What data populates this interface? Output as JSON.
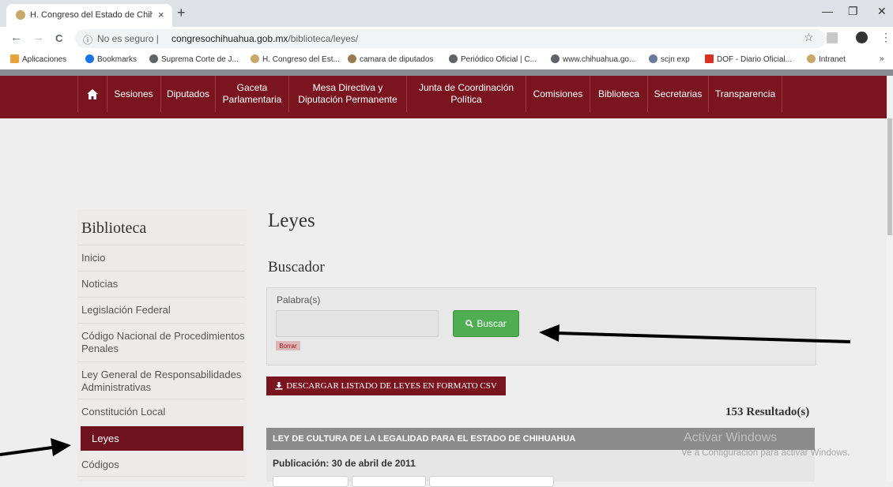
{
  "browser": {
    "tab_title": "H. Congreso del Estado de Chihu",
    "tab_close": "×",
    "new_tab": "+",
    "window_controls": [
      "—",
      "❐",
      "✕"
    ],
    "nav": {
      "back": "←",
      "forward": "→",
      "reload": "C"
    },
    "address": {
      "security_icon": "ⓘ",
      "security_text": "No es seguro  |",
      "url_domain": "congresochihuahua.gob.mx",
      "url_path": "/biblioteca/leyes/"
    },
    "toolbar_icons": [
      "☆",
      "⋮"
    ],
    "bookmarks": [
      {
        "label": "Aplicaciones",
        "icon": "apps-icon",
        "color": "#e8a33a"
      },
      {
        "label": "Bookmarks",
        "icon": "star-icon",
        "color": "#1a73e8"
      },
      {
        "label": "Suprema Corte de J...",
        "icon": "globe-icon",
        "color": "#5f6368"
      },
      {
        "label": "H. Congreso del Est...",
        "icon": "seal-icon",
        "color": "#c8a86a"
      },
      {
        "label": "camara de diputados",
        "icon": "seal-icon",
        "color": "#9a7b4f"
      },
      {
        "label": "Periódico Oficial | C...",
        "icon": "globe-icon",
        "color": "#5f6368"
      },
      {
        "label": "www.chihuahua.go...",
        "icon": "globe-icon",
        "color": "#5f6368"
      },
      {
        "label": "scjn exp",
        "icon": "bird-icon",
        "color": "#6b7a99"
      },
      {
        "label": "DOF - Diario Oficial...",
        "icon": "dof-icon",
        "color": "#d93025"
      },
      {
        "label": "Intranet",
        "icon": "seal-icon",
        "color": "#c8a86a"
      }
    ],
    "bookmarks_more": "»"
  },
  "site_nav": {
    "home_icon": "home-icon",
    "items": [
      "Sesiones",
      "Diputados",
      "Gaceta Parlamentaria",
      "Mesa Directiva y Diputación Permanente",
      "Junta de Coordinación Política",
      "Comisiones",
      "Biblioteca",
      "Secretarias",
      "Transparencia"
    ]
  },
  "sidebar": {
    "title": "Biblioteca",
    "items": [
      "Inicio",
      "Noticias",
      "Legislación Federal",
      "Código Nacional de Procedimientos Penales",
      "Ley General de Responsabilidades Administrativas",
      "Constitución Local",
      "Leyes",
      "Códigos"
    ],
    "active": "Leyes"
  },
  "main": {
    "heading": "Leyes",
    "search_heading": "Buscador",
    "field_label": "Palabra(s)",
    "field_value": "",
    "search_button": "Buscar",
    "clear_button": "Borrar",
    "csv_button": "DESCARGAR LISTADO DE LEYES EN FORMATO CSV",
    "results_count": "153 Resultado(s)",
    "first_law": {
      "title": "LEY DE CULTURA DE LA LEGALIDAD PARA EL ESTADO DE CHIHUAHUA",
      "publication": "Publicación: 30 de abril de 2011"
    }
  },
  "overlay": {
    "watermark_title": "Activar Windows",
    "watermark_sub": "Ve a Configuración para activar Windows."
  },
  "colors": {
    "brand": "#7a1520",
    "search_green": "#4fae52"
  }
}
